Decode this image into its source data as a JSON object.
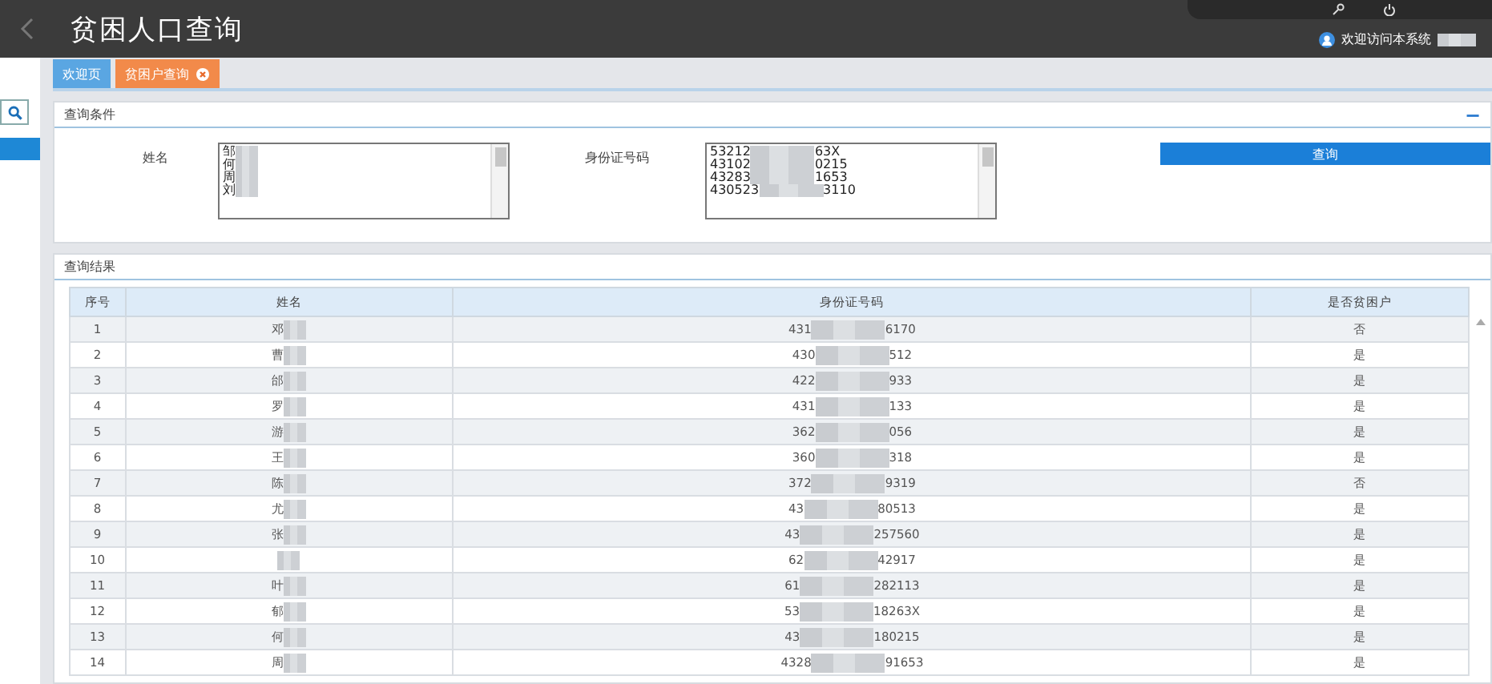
{
  "header": {
    "title": "贫困人口查询",
    "welcome": "欢迎访问本系统"
  },
  "tabs": [
    {
      "label": "欢迎页",
      "selected": false,
      "closable": false
    },
    {
      "label": "贫困户查询",
      "selected": true,
      "closable": true
    }
  ],
  "query_panel": {
    "title": "查询条件",
    "collapse": "−",
    "name_label": "姓名",
    "name_lines": [
      "邹",
      "何",
      "周",
      "刘"
    ],
    "id_label": "身份证号码",
    "id_lines": [
      {
        "start": "53212",
        "end": "63X"
      },
      {
        "start": "43102",
        "end": "0215"
      },
      {
        "start": "43283",
        "end": "1653"
      },
      {
        "start": "430523",
        "end": "3110"
      }
    ],
    "button": "查询"
  },
  "results_panel": {
    "title": "查询结果",
    "columns": [
      "序号",
      "姓名",
      "身份证号码",
      "是否贫困户"
    ],
    "rows": [
      {
        "index": "1",
        "name": "邓",
        "id_start": "431",
        "id_end": "6170",
        "poor": "否"
      },
      {
        "index": "2",
        "name": "曹",
        "id_start": "430",
        "id_end": "512",
        "poor": "是"
      },
      {
        "index": "3",
        "name": "邰",
        "id_start": "422",
        "id_end": "933",
        "poor": "是"
      },
      {
        "index": "4",
        "name": "罗",
        "id_start": "431",
        "id_end": "133",
        "poor": "是"
      },
      {
        "index": "5",
        "name": "游",
        "id_start": "362",
        "id_end": "056",
        "poor": "是"
      },
      {
        "index": "6",
        "name": "王",
        "id_start": "360",
        "id_end": "318",
        "poor": "是"
      },
      {
        "index": "7",
        "name": "陈",
        "id_start": "372",
        "id_end": "9319",
        "poor": "否"
      },
      {
        "index": "8",
        "name": "尤",
        "id_start": "43",
        "id_end": "80513",
        "poor": "是"
      },
      {
        "index": "9",
        "name": "张",
        "id_start": "43",
        "id_end": "257560",
        "poor": "是"
      },
      {
        "index": "10",
        "name": "",
        "id_start": "62",
        "id_end": "42917",
        "poor": "是"
      },
      {
        "index": "11",
        "name": "叶",
        "id_start": "61",
        "id_end": "282113",
        "poor": "是"
      },
      {
        "index": "12",
        "name": "郁",
        "id_start": "53",
        "id_end": "18263X",
        "poor": "是"
      },
      {
        "index": "13",
        "name": "何",
        "id_start": "43",
        "id_end": "180215",
        "poor": "是"
      },
      {
        "index": "14",
        "name": "周",
        "id_start": "4328",
        "id_end": "91653",
        "poor": "是"
      }
    ]
  }
}
